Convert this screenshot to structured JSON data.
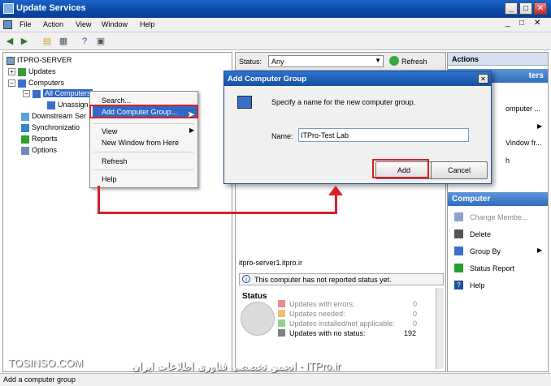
{
  "window": {
    "title": "Update Services",
    "controls": [
      "_",
      "□",
      "✕"
    ],
    "inner_controls": [
      "_",
      "□",
      "✕"
    ]
  },
  "menu": [
    "File",
    "Action",
    "View",
    "Window",
    "Help"
  ],
  "tree": {
    "server": "ITPRO-SERVER",
    "updates": "Updates",
    "computers": "Computers",
    "all_computers": "All Computers",
    "unassigned": "Unassign",
    "downstream": "Downstream Ser",
    "synchronizations": "Synchronizatio",
    "reports": "Reports",
    "options": "Options"
  },
  "context_menu": {
    "search": "Search...",
    "add_group": "Add Computer Group...",
    "view": "View",
    "new_window": "New Window from Here",
    "refresh": "Refresh",
    "help": "Help"
  },
  "middle": {
    "status_label": "Status:",
    "status_value": "Any",
    "refresh": "Refresh",
    "server_name": "itpro-server1.itpro.ir",
    "info_text": "This computer has not reported status yet.",
    "status_heading": "Status",
    "legend": [
      {
        "label": "Updates with errors:",
        "value": "0",
        "color": "#e58e8e"
      },
      {
        "label": "Updates needed:",
        "value": "0",
        "color": "#f0c070"
      },
      {
        "label": "Updates installed/not applicable:",
        "value": "0",
        "color": "#8fd08f"
      },
      {
        "label": "Updates with no status:",
        "value": "192",
        "color": "#808080"
      }
    ]
  },
  "actions": {
    "heading": "Actions",
    "top_header_fragment": "ters",
    "partials": [
      "omputer ...",
      "Vindow fr...",
      "h"
    ],
    "computer_header": "Computer",
    "items": [
      {
        "label": "Change Membe...",
        "icon": "change-membership-icon",
        "disabled": true
      },
      {
        "label": "Delete",
        "icon": "delete-icon",
        "disabled": false
      },
      {
        "label": "Group By",
        "icon": "group-by-icon",
        "disabled": false
      },
      {
        "label": "Status Report",
        "icon": "status-report-icon",
        "disabled": false
      },
      {
        "label": "Help",
        "icon": "help-icon",
        "disabled": false
      }
    ]
  },
  "dialog": {
    "title": "Add Computer Group",
    "close": "✕",
    "instruction": "Specify a name for the new computer group.",
    "name_label": "Name:",
    "name_value": "ITPro-Test Lab",
    "add": "Add",
    "cancel": "Cancel"
  },
  "statusbar": {
    "text": "Add a computer group"
  },
  "watermark": {
    "left": "TOSINSO.COM",
    "right": "انجمن تخصصی فناوری اطلاعات ایران - ITPro.ir"
  }
}
